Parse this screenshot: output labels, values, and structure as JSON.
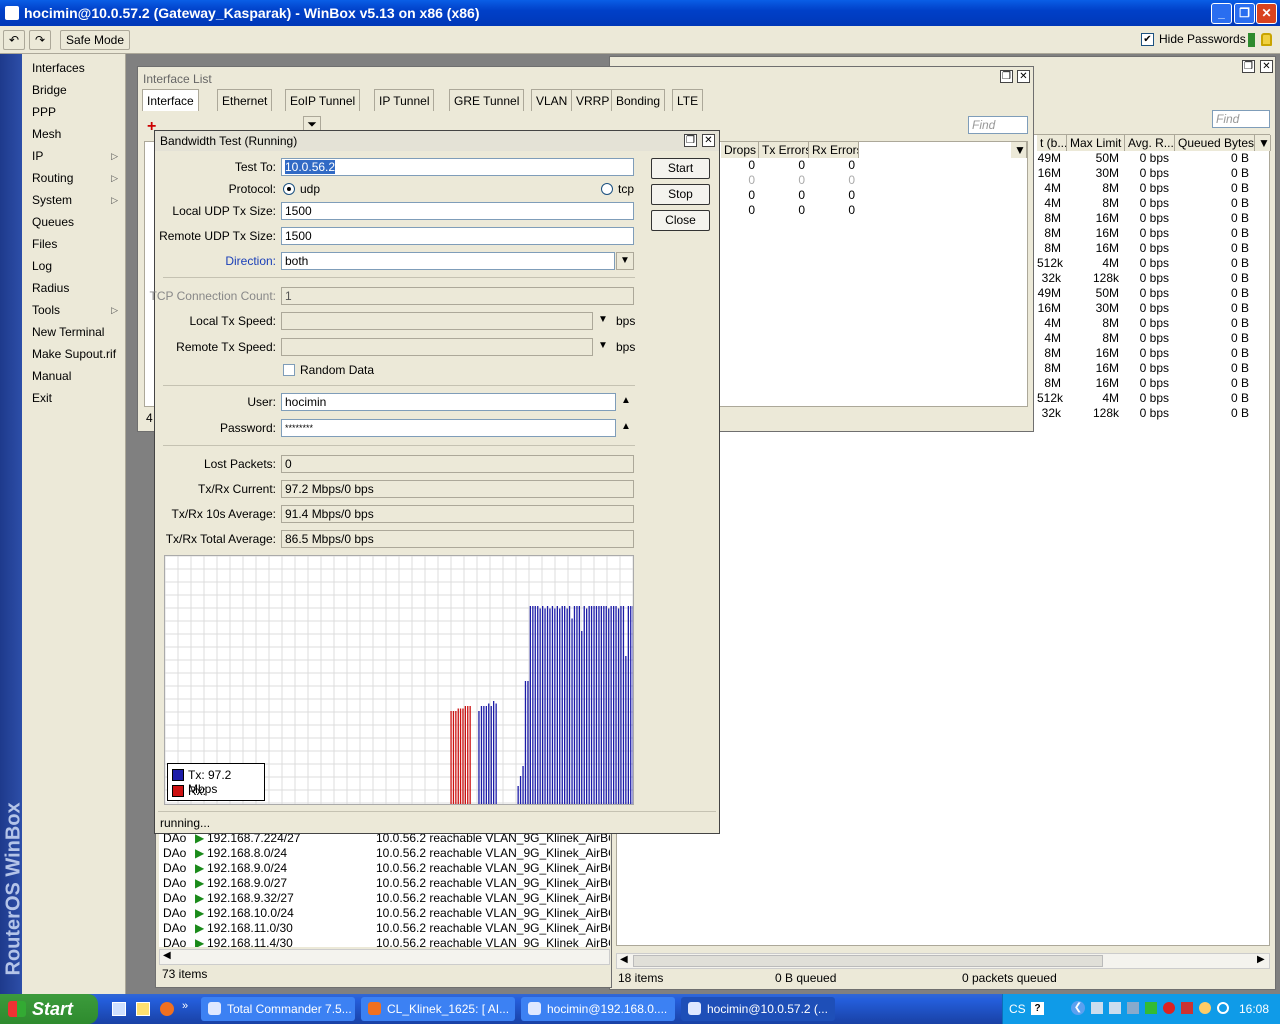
{
  "titlebar": {
    "title": "hocimin@10.0.57.2 (Gateway_Kasparak) - WinBox v5.13 on x86 (x86)"
  },
  "toolbar": {
    "safe_mode": "Safe Mode",
    "hide_passwords": "Hide Passwords"
  },
  "sidebar": {
    "brand": "RouterOS WinBox",
    "items": [
      {
        "label": "Interfaces",
        "sub": false
      },
      {
        "label": "Bridge",
        "sub": false
      },
      {
        "label": "PPP",
        "sub": false
      },
      {
        "label": "Mesh",
        "sub": false
      },
      {
        "label": "IP",
        "sub": true
      },
      {
        "label": "Routing",
        "sub": true
      },
      {
        "label": "System",
        "sub": true
      },
      {
        "label": "Queues",
        "sub": false
      },
      {
        "label": "Files",
        "sub": false
      },
      {
        "label": "Log",
        "sub": false
      },
      {
        "label": "Radius",
        "sub": false
      },
      {
        "label": "Tools",
        "sub": true
      },
      {
        "label": "New Terminal",
        "sub": false
      },
      {
        "label": "Make Supout.rif",
        "sub": false
      },
      {
        "label": "Manual",
        "sub": false
      },
      {
        "label": "Exit",
        "sub": false
      }
    ]
  },
  "iface": {
    "title": "Interface List",
    "tabs": [
      "Interface",
      "Ethernet",
      "EoIP Tunnel",
      "IP Tunnel",
      "GRE Tunnel",
      "VLAN",
      "VRRP",
      "Bonding",
      "LTE"
    ],
    "find": "Find",
    "cols": [
      "Drops",
      "Tx Errors",
      "Rx Errors"
    ],
    "rows": [
      [
        "0",
        "0",
        "0"
      ],
      [
        "0",
        "0",
        "0"
      ],
      [
        "0",
        "0",
        "0"
      ],
      [
        "0",
        "0",
        "0"
      ]
    ],
    "status": "4"
  },
  "queue": {
    "find": "Find",
    "cols": [
      "t (b...",
      "Max Limit ...",
      "Avg. R...",
      "Queued Bytes"
    ],
    "rows": [
      [
        "49M",
        "50M",
        "0 bps",
        "0 B"
      ],
      [
        "16M",
        "30M",
        "0 bps",
        "0 B"
      ],
      [
        "4M",
        "8M",
        "0 bps",
        "0 B"
      ],
      [
        "4M",
        "8M",
        "0 bps",
        "0 B"
      ],
      [
        "8M",
        "16M",
        "0 bps",
        "0 B"
      ],
      [
        "8M",
        "16M",
        "0 bps",
        "0 B"
      ],
      [
        "8M",
        "16M",
        "0 bps",
        "0 B"
      ],
      [
        "512k",
        "4M",
        "0 bps",
        "0 B"
      ],
      [
        "32k",
        "128k",
        "0 bps",
        "0 B"
      ],
      [
        "49M",
        "50M",
        "0 bps",
        "0 B"
      ],
      [
        "16M",
        "30M",
        "0 bps",
        "0 B"
      ],
      [
        "4M",
        "8M",
        "0 bps",
        "0 B"
      ],
      [
        "4M",
        "8M",
        "0 bps",
        "0 B"
      ],
      [
        "8M",
        "16M",
        "0 bps",
        "0 B"
      ],
      [
        "8M",
        "16M",
        "0 bps",
        "0 B"
      ],
      [
        "8M",
        "16M",
        "0 bps",
        "0 B"
      ],
      [
        "512k",
        "4M",
        "0 bps",
        "0 B"
      ],
      [
        "32k",
        "128k",
        "0 bps",
        "0 B"
      ]
    ],
    "status": [
      "18 items",
      "0 B queued",
      "0 packets queued"
    ]
  },
  "routes": {
    "rows": [
      [
        "DAo",
        "192.168.7.224/27",
        "10.0.56.2 reachable VLAN_9G_Klinek_AirBQ"
      ],
      [
        "DAo",
        "192.168.8.0/24",
        "10.0.56.2 reachable VLAN_9G_Klinek_AirBQ"
      ],
      [
        "DAo",
        "192.168.9.0/24",
        "10.0.56.2 reachable VLAN_9G_Klinek_AirBQ"
      ],
      [
        "DAo",
        "192.168.9.0/27",
        "10.0.56.2 reachable VLAN_9G_Klinek_AirBQ"
      ],
      [
        "DAo",
        "192.168.9.32/27",
        "10.0.56.2 reachable VLAN_9G_Klinek_AirBQ"
      ],
      [
        "DAo",
        "192.168.10.0/24",
        "10.0.56.2 reachable VLAN_9G_Klinek_AirBQ"
      ],
      [
        "DAo",
        "192.168.11.0/30",
        "10.0.56.2 reachable VLAN_9G_Klinek_AirBQ"
      ],
      [
        "DAo",
        "192.168.11.4/30",
        "10.0.56.2 reachable VLAN_9G_Klinek_AirBQ"
      ]
    ],
    "status": "73 items"
  },
  "bw": {
    "title": "Bandwidth Test (Running)",
    "labels": {
      "test_to": "Test To:",
      "protocol": "Protocol:",
      "local_udp": "Local UDP Tx Size:",
      "remote_udp": "Remote UDP Tx Size:",
      "direction": "Direction:",
      "tcp_count": "TCP Connection Count:",
      "local_speed": "Local Tx Speed:",
      "remote_speed": "Remote Tx Speed:",
      "random": "Random Data",
      "user": "User:",
      "password": "Password:",
      "lost": "Lost Packets:",
      "current": "Tx/Rx Current:",
      "avg10": "Tx/Rx 10s Average:",
      "total": "Tx/Rx Total Average:"
    },
    "values": {
      "test_to": "10.0.56.2",
      "udp": "udp",
      "tcp": "tcp",
      "local_udp": "1500",
      "remote_udp": "1500",
      "direction": "both",
      "tcp_count": "1",
      "bps": "bps",
      "user": "hocimin",
      "password": "********",
      "lost": "0",
      "current": "97.2 Mbps/0 bps",
      "avg10": "91.4 Mbps/0 bps",
      "total": "86.5 Mbps/0 bps"
    },
    "buttons": {
      "start": "Start",
      "stop": "Stop",
      "close": "Close"
    },
    "legend": {
      "tx": "Tx:  97.2 Mbps",
      "rx": "Rx:"
    },
    "status": "running...",
    "colors": {
      "tx": "#1c1ca8",
      "rx": "#cc1111"
    }
  },
  "chart_data": {
    "type": "bar",
    "title": "",
    "series": [
      {
        "name": "Tx",
        "color": "#1c1ca8",
        "values": [
          0,
          0,
          0,
          0,
          0,
          0,
          0,
          0,
          0,
          0,
          0,
          0,
          0,
          0,
          0,
          0,
          0,
          0,
          0,
          0,
          0,
          0,
          0,
          0,
          0,
          0,
          0,
          0,
          0,
          0,
          0,
          0,
          0,
          0,
          0,
          0,
          0,
          0,
          0,
          0,
          0,
          0,
          0,
          0,
          0,
          0,
          0,
          0,
          0,
          0,
          0,
          0,
          0,
          0,
          0,
          0,
          0,
          0,
          0,
          0,
          0,
          0,
          0,
          0,
          0,
          0,
          0,
          0,
          0,
          0,
          0,
          0,
          0,
          0,
          0,
          0,
          0,
          0,
          0,
          0,
          0,
          0,
          0,
          0,
          0,
          0,
          0,
          0,
          0,
          0,
          0,
          0,
          0,
          0,
          0,
          0,
          0,
          0,
          0,
          0,
          0,
          0,
          0,
          0,
          0,
          0,
          0,
          0,
          0,
          0,
          0,
          0,
          0,
          0,
          0,
          0,
          0,
          0,
          0,
          0,
          0,
          0,
          0,
          0,
          0,
          0,
          0,
          0,
          38,
          40,
          40,
          40,
          41,
          40,
          42,
          41,
          0,
          0,
          0,
          0,
          0,
          0,
          0,
          0,
          8,
          12,
          16,
          50,
          50,
          80,
          80,
          80,
          80,
          79,
          80,
          79,
          80,
          79,
          80,
          79,
          80,
          79,
          80,
          80,
          79,
          80,
          75,
          80,
          80,
          80,
          70,
          80,
          79,
          80,
          80,
          80,
          80,
          80,
          80,
          80,
          80,
          79,
          80,
          80,
          80,
          79,
          80,
          80,
          60,
          80,
          80,
          80
        ]
      },
      {
        "name": "Rx",
        "color": "#cc1111",
        "values": [
          0,
          0,
          0,
          0,
          0,
          0,
          0,
          0,
          0,
          0,
          0,
          0,
          0,
          0,
          0,
          0,
          0,
          0,
          0,
          0,
          0,
          0,
          0,
          0,
          0,
          0,
          0,
          0,
          0,
          0,
          0,
          0,
          0,
          0,
          0,
          0,
          0,
          0,
          0,
          0,
          0,
          0,
          0,
          0,
          0,
          0,
          0,
          0,
          0,
          0,
          0,
          0,
          0,
          0,
          0,
          0,
          0,
          0,
          0,
          0,
          0,
          0,
          0,
          0,
          0,
          0,
          0,
          0,
          0,
          0,
          0,
          0,
          0,
          0,
          0,
          0,
          0,
          0,
          0,
          0,
          0,
          0,
          0,
          0,
          0,
          0,
          0,
          0,
          0,
          0,
          0,
          0,
          0,
          0,
          0,
          0,
          0,
          0,
          0,
          0,
          0,
          0,
          0,
          0,
          0,
          0,
          0,
          0,
          0,
          0,
          0,
          0,
          0,
          0,
          0,
          0,
          0,
          0,
          0,
          38,
          38,
          38,
          39,
          39,
          39,
          40,
          40,
          40,
          0,
          0,
          0,
          0,
          0,
          0,
          0,
          0,
          0,
          0,
          0,
          0,
          0,
          0,
          0,
          0,
          0,
          0,
          0,
          0,
          0,
          0,
          0,
          0,
          0,
          0,
          0,
          0,
          0,
          0,
          0,
          0,
          0,
          0,
          0,
          0,
          0,
          0,
          0,
          0,
          0,
          0,
          0,
          0,
          0,
          0,
          0,
          0,
          0,
          0,
          0,
          0,
          0,
          0,
          0,
          0,
          0,
          0,
          0,
          0,
          0,
          0,
          0,
          0,
          0,
          0,
          0,
          0
        ]
      }
    ],
    "ylim": [
      0,
      100
    ]
  },
  "taskbar": {
    "start": "Start",
    "tasks": [
      "Total Commander 7.5...",
      "CL_Klinek_1625: [ AI...",
      "hocimin@192.168.0....",
      "hocimin@10.0.57.2 (..."
    ],
    "lang": "CS",
    "time": "16:08"
  }
}
